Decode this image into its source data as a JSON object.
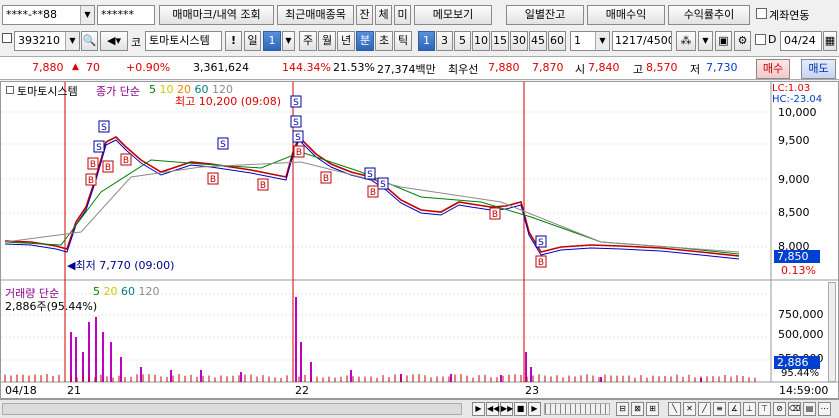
{
  "toolbar1": {
    "account_masked": "****-**88",
    "password_masked": "******",
    "tx_button": "매매마크/내역 조회",
    "recent_button": "최근매매종목",
    "balance_button": "잔",
    "exec_button": "체",
    "unexec_button": "미",
    "memo_button": "메모보기",
    "daily_balance_button": "일별잔고",
    "trade_profit_button": "매매수익",
    "return_trend_button": "수익률추이",
    "account_link_label": "계좌연동"
  },
  "toolbar2": {
    "stock_code": "393210",
    "stock_prefix": "코",
    "stock_name": "토마토시스템",
    "alert_btn": "!",
    "period_select": "일",
    "period_value": "1",
    "periods": [
      "주",
      "월",
      "년",
      "분",
      "초",
      "틱"
    ],
    "selected_period": "분",
    "intervals": [
      "1",
      "3",
      "5",
      "10",
      "15",
      "30",
      "45",
      "60"
    ],
    "selected_interval": "1",
    "custom_interval": "1",
    "data_count": "1217",
    "data_total": "/4500",
    "d_label": "D",
    "date_value": "04/24"
  },
  "quote": {
    "price": "7,880",
    "change": "70",
    "change_pct": "+0.90%",
    "volume": "3,361,624",
    "vol_ratio": "144.34%",
    "turnover_rate": "21.53%",
    "amount": "27,374백만",
    "priority_label": "최우선",
    "bid1": "7,880",
    "bid2": "7,870",
    "open_label": "시",
    "open": "7,840",
    "high_label": "고",
    "high": "8,570",
    "low_label": "저",
    "low": "7,730",
    "buy_button": "매수",
    "sell_button": "매도"
  },
  "chart": {
    "stock_name": "토마토시스템",
    "price_legend_title": "종가 단순",
    "ma_periods": [
      "5",
      "10",
      "20",
      "60",
      "120"
    ],
    "ma_colors": [
      "#008000",
      "#cccc00",
      "#ff8000",
      "#008080",
      "#8c8c8c"
    ],
    "high_note": "최고 10,200 (09:08)",
    "low_note": "최저 7,770 (09:00)",
    "lc_label": "LC:1.03",
    "hc_label": "HC:-23.04",
    "price_ticks": [
      "10,000",
      "9,500",
      "9,000",
      "8,500",
      "8,000"
    ],
    "current_price_tag": "7,850",
    "current_pct_tag": "0.13%",
    "volume_legend_title": "거래량 단순",
    "volume_ma_periods": [
      "5",
      "20",
      "60",
      "120"
    ],
    "volume_info": "2,886주(95.44%)",
    "volume_ticks": [
      "750,000",
      "500,000",
      "250,000"
    ],
    "current_volume_tag": "2,886",
    "current_volume_pct": "95.44%",
    "x_labels": [
      "04/18",
      "21",
      "22",
      "23"
    ],
    "time_readout": "14:59:00"
  }
}
